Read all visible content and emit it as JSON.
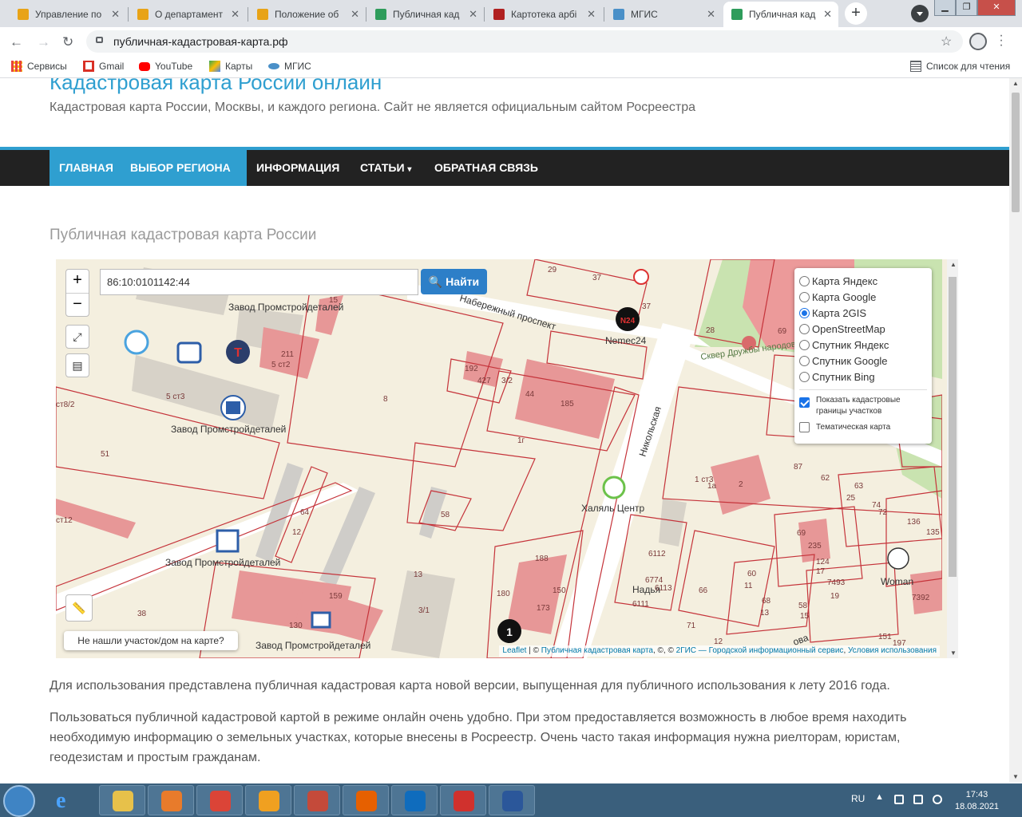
{
  "tabs": [
    {
      "label": "Управление по",
      "color": "#e8a317"
    },
    {
      "label": "О департамент",
      "color": "#e8a317"
    },
    {
      "label": "Положение об",
      "color": "#e8a317"
    },
    {
      "label": "Публичная кад",
      "color": "#2e9c5b"
    },
    {
      "label": "Картотека арбі",
      "color": "#b02020"
    },
    {
      "label": "МГИС",
      "color": "#4a90c8"
    },
    {
      "label": "Публичная кад",
      "color": "#2e9c5b"
    }
  ],
  "address": {
    "url": "публичная-кадастровая-карта.рф"
  },
  "bookmarks": {
    "items": [
      {
        "label": "Сервисы",
        "color": "#e8453c"
      },
      {
        "label": "Gmail",
        "color": "#d93025"
      },
      {
        "label": "YouTube",
        "color": "#ff0000"
      },
      {
        "label": "Карты",
        "color": "#34a853"
      },
      {
        "label": "МГИС",
        "color": "#4a90c8"
      }
    ],
    "reading_list": "Список для чтения"
  },
  "site": {
    "title": "Кадастровая карта России онлайн",
    "subtitle": "Кадастровая карта России, Москвы, и каждого региона. Сайт не является официальным сайтом Росреестра",
    "accent": "#2f9fd0",
    "nav": [
      "ГЛАВНАЯ",
      "ВЫБОР РЕГИОНА",
      "ИНФОРМАЦИЯ",
      "СТАТЬИ",
      "ОБРАТНАЯ СВЯЗЬ"
    ]
  },
  "page": {
    "heading": "Публичная кадастровая карта России",
    "para1": "Для использования представлена публичная кадастровая карта новой версии, выпущенная для публичного использования к лету 2016 года.",
    "para2": "Пользоваться публичной кадастровой картой в режиме онлайн очень удобно. При этом предоставляется возможность в любое время находить необходимую информацию о земельных участках, которые внесены в Росреестр. Очень часто такая информация нужна риелторам, юристам, геодезистам и простым гражданам."
  },
  "map": {
    "zoom_in": "+",
    "zoom_out": "−",
    "search_value": "86:10:0101142:44",
    "search_button": "Найти",
    "layers": [
      {
        "label": "Карта Яндекс",
        "selected": false
      },
      {
        "label": "Карта Google",
        "selected": false
      },
      {
        "label": "Карта 2GIS",
        "selected": true
      },
      {
        "label": "OpenStreetMap",
        "selected": false
      },
      {
        "label": "Спутник Яндекс",
        "selected": false
      },
      {
        "label": "Спутник Google",
        "selected": false
      },
      {
        "label": "Спутник Bing",
        "selected": false
      }
    ],
    "show_boundaries": "Показать кадастровые границы участков",
    "show_boundaries_checked": true,
    "thematic": "Тематическая карта",
    "thematic_checked": false,
    "not_found": "Не нашли участок/дом на карте?",
    "attribution": {
      "leaflet": "Leaflet",
      "sep1": " | © ",
      "pkk": "Публичная кадастровая карта",
      "mid": ", ©, © ",
      "dgis": "2ГИС — Городской информационный сервис",
      "sep2": ", ",
      "terms": "Условия использования"
    },
    "labels": {
      "zavod": "Завод Промстройдеталей",
      "nemec": "Nemec24",
      "halal": "Халяль Центр",
      "nadya": "Надья",
      "woman": "Woman",
      "nab": "Набережный проспект",
      "nik": "Никольская",
      "skver": "Сквер Дружбы народов",
      "ova": "ова"
    },
    "numbers": [
      "192",
      "427",
      "3/2",
      "44",
      "185",
      "1г",
      "8",
      "211",
      "5 ст2",
      "5 ст3",
      "ст8/2",
      "51",
      "ст12",
      "58",
      "64",
      "12",
      "159",
      "130",
      "13",
      "3/1",
      "180",
      "173",
      "150",
      "188",
      "38",
      "29",
      "37",
      "37",
      "28",
      "69",
      "6112",
      "6774",
      "6113",
      "6111",
      "66",
      "60",
      "11",
      "68",
      "13",
      "58",
      "15",
      "124",
      "17",
      "7493",
      "19",
      "69",
      "235",
      "62",
      "63",
      "25",
      "74",
      "72",
      "136",
      "135",
      "7392",
      "1а",
      "2",
      "1 ст3",
      "87",
      "71",
      "12",
      "151",
      "197",
      "15"
    ]
  },
  "taskbar": {
    "lang": "RU",
    "time": "17:43",
    "date": "18.08.2021",
    "apps": [
      {
        "name": "explorer",
        "color": "#e7c14a"
      },
      {
        "name": "media",
        "color": "#e87b2b"
      },
      {
        "name": "chrome",
        "color": "#db4437"
      },
      {
        "name": "app-orange",
        "color": "#f0a020"
      },
      {
        "name": "app-house",
        "color": "#c44a3a"
      },
      {
        "name": "firefox",
        "color": "#e66000"
      },
      {
        "name": "outlook",
        "color": "#0f6cbd"
      },
      {
        "name": "app-red",
        "color": "#d0312d"
      },
      {
        "name": "word",
        "color": "#2b579a"
      }
    ]
  }
}
